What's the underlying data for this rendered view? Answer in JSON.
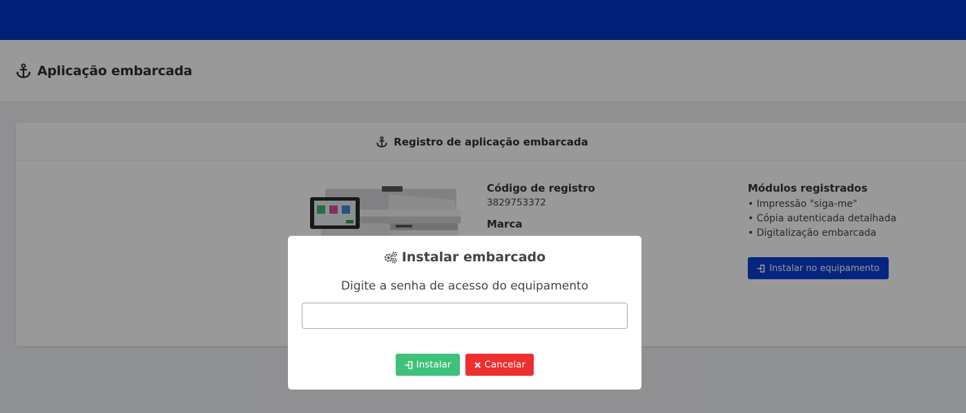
{
  "header": {
    "title": "Aplicação embarcada",
    "icon": "anchor-icon"
  },
  "card": {
    "title": "Registro de aplicação embarcada",
    "icon": "anchor-icon",
    "registration_code_label": "Código de registro",
    "registration_code_value": "3829753372",
    "brand_label": "Marca",
    "modules_label": "Módulos registrados",
    "modules": [
      "• Impressão \"siga-me\"",
      "• Cópia autenticada detalhada",
      "• Digitalização embarcada"
    ],
    "install_device_label": "Instalar no equipamento",
    "install_device_icon": "sign-in-icon"
  },
  "modal": {
    "title": "Instalar embarcado",
    "title_icon": "gears-icon",
    "prompt": "Digite a senha de acesso do equipamento",
    "password_value": "",
    "install_label": "Instalar",
    "install_icon": "sign-in-icon",
    "cancel_label": "Cancelar",
    "cancel_icon": "close-icon"
  },
  "colors": {
    "topbar": "#0036c9",
    "primary_button": "#0a3fd6",
    "success": "#3ec27a",
    "danger": "#ee2f2f"
  }
}
